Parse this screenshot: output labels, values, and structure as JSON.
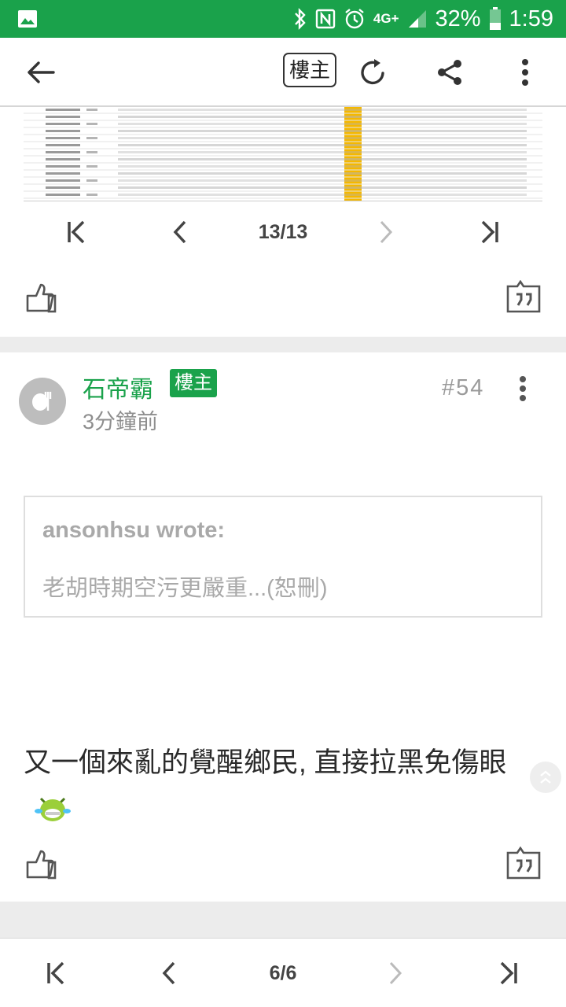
{
  "status_bar": {
    "network": "4G+",
    "battery": "32%",
    "time": "1:59",
    "icons": [
      "image-notification-icon",
      "bluetooth-icon",
      "nfc-icon",
      "alarm-icon",
      "signal-icon",
      "battery-icon"
    ]
  },
  "toolbar": {
    "owner_filter_label": "樓主",
    "icons": [
      "back-arrow-icon",
      "refresh-icon",
      "share-icon",
      "more-vertical-icon"
    ]
  },
  "image_pager": {
    "label": "13/13"
  },
  "post": {
    "author": "石帝霸",
    "owner_badge": "樓主",
    "time": "3分鐘前",
    "floor": "#54",
    "quote": {
      "author": "ansonhsu wrote:",
      "text": "老胡時期空污更嚴重...(恕刪)"
    },
    "body": "又一個來亂的覺醒鄉民, 直接拉黑免傷眼"
  },
  "bottom_pager": {
    "label": "6/6"
  },
  "colors": {
    "brand_green": "#1aa24b",
    "highlight_orange": "#f5b800",
    "muted_gray": "#a9a9a9"
  }
}
